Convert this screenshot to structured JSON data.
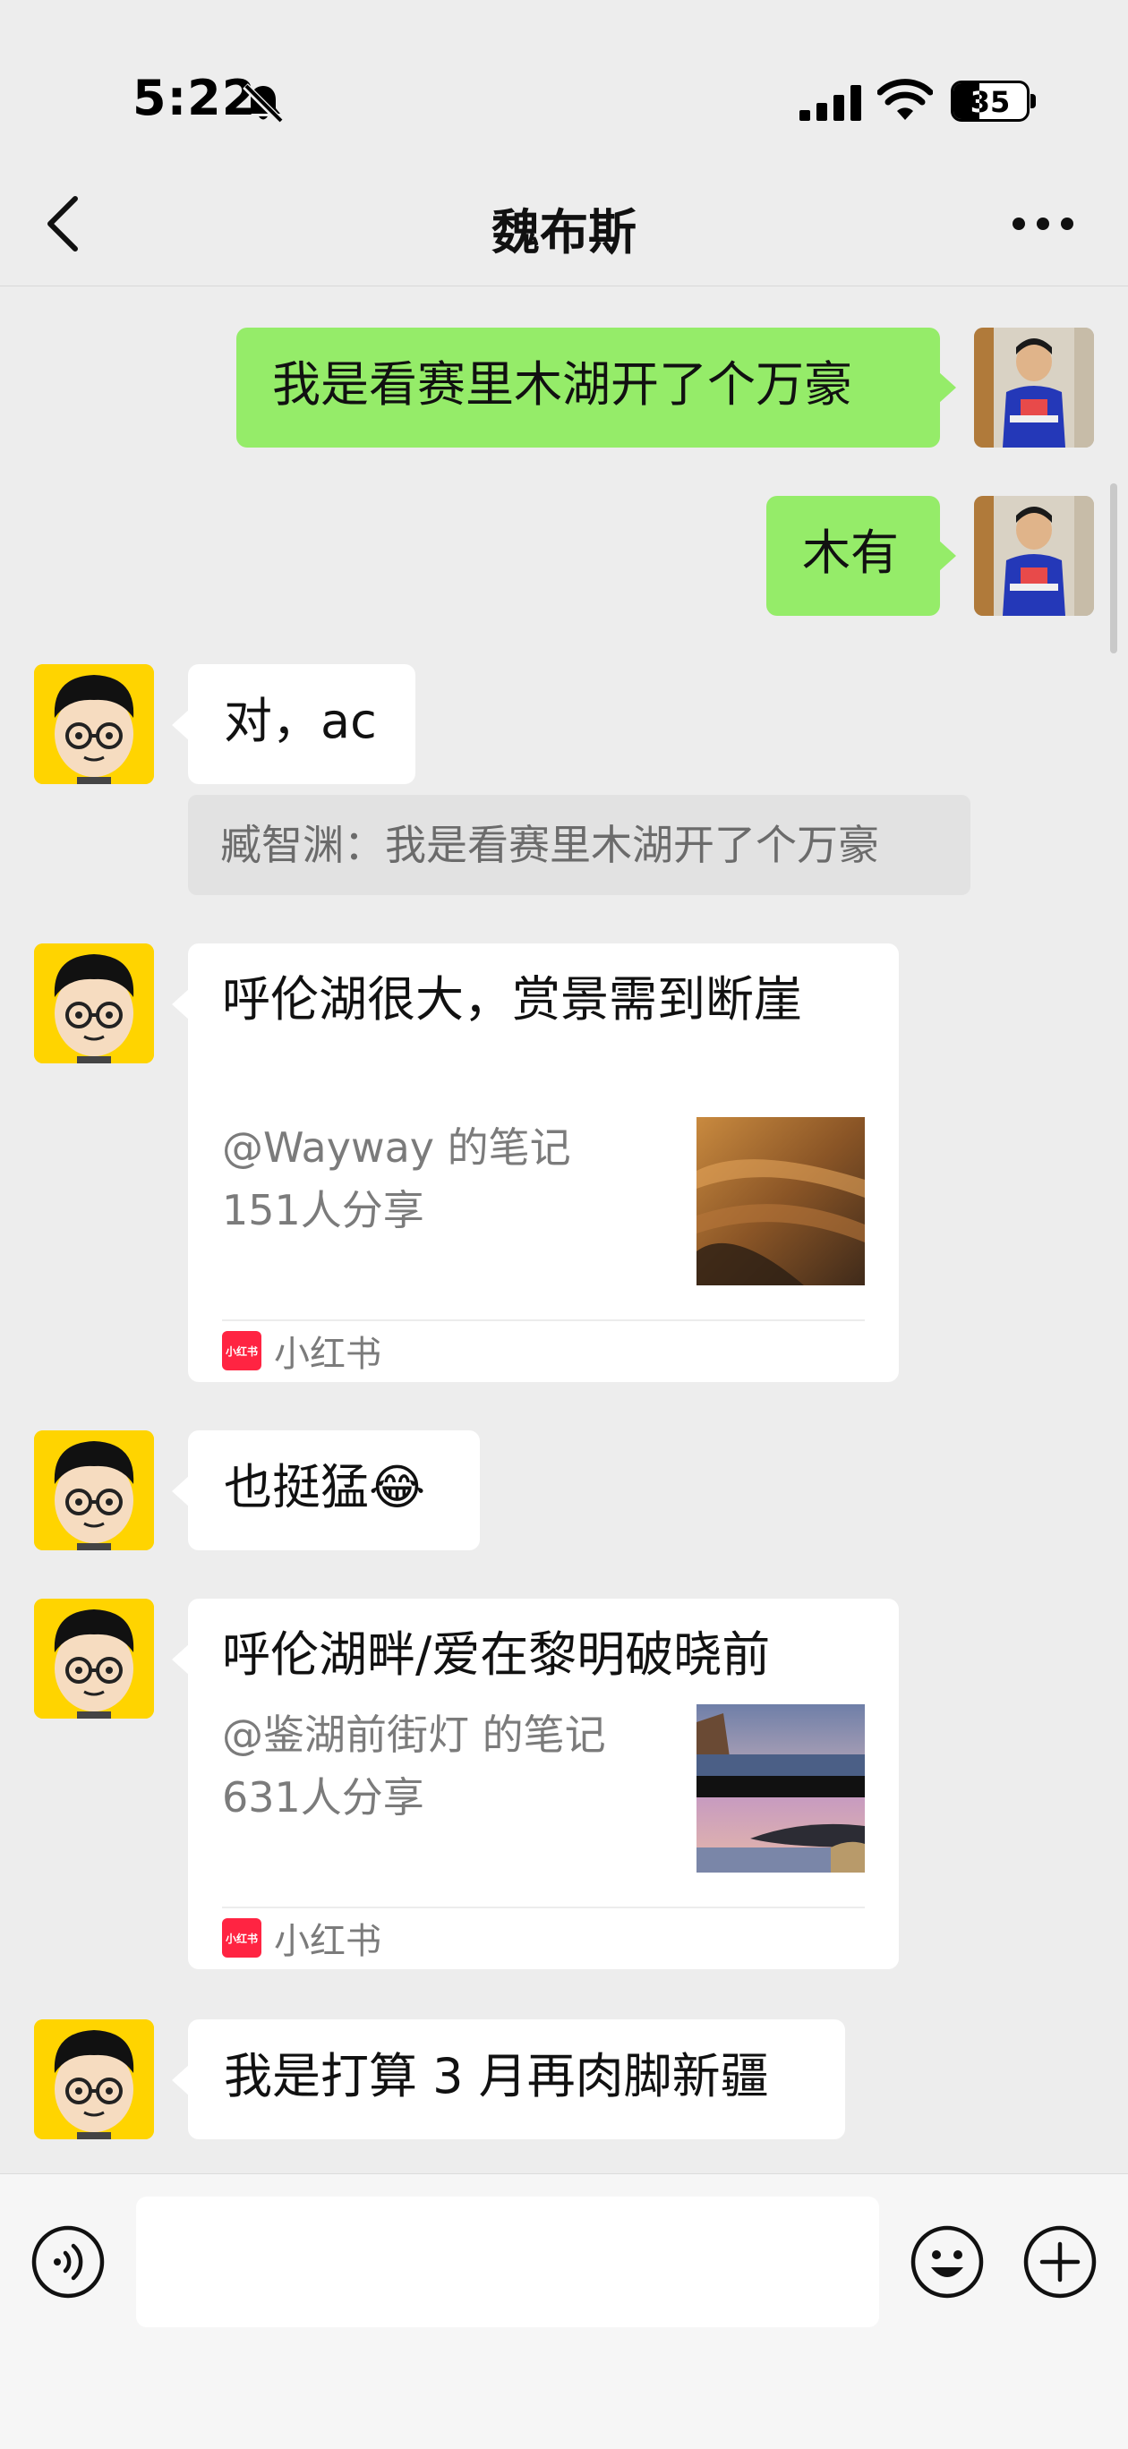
{
  "status_bar": {
    "time": "5:22",
    "battery_level": "35",
    "icons": [
      "bell-mute-icon",
      "cellular-signal-icon",
      "wifi-icon",
      "battery-icon"
    ]
  },
  "nav": {
    "title": "魏布斯",
    "back_icon": "chevron-left-icon",
    "more_icon": "ellipsis-icon"
  },
  "messages": [
    {
      "from": "self",
      "text": "我是看赛里木湖开了个万豪"
    },
    {
      "from": "self",
      "text": "木有"
    },
    {
      "from": "other",
      "text": "对，ac",
      "quote": "臧智渊：我是看赛里木湖开了个万豪"
    },
    {
      "from": "other",
      "type": "card",
      "title": "呼伦湖很大，赏景需到断崖",
      "author": "@Wayway 的笔记",
      "shares": "151人分享",
      "source": "小红书",
      "logo_text": "小红书"
    },
    {
      "from": "other",
      "text": "也挺猛😂"
    },
    {
      "from": "other",
      "type": "card",
      "title": "呼伦湖畔/爱在黎明破晓前",
      "author": "@鉴湖前街灯 的笔记",
      "shares": "631人分享",
      "source": "小红书",
      "logo_text": "小红书"
    },
    {
      "from": "other",
      "text": "我是打算 3 月再肉脚新疆"
    }
  ],
  "input_bar": {
    "placeholder": "",
    "icons": [
      "voice-icon",
      "emoji-icon",
      "plus-icon"
    ]
  },
  "colors": {
    "background": "#ededed",
    "self_bubble": "#95ec69",
    "other_bubble": "#ffffff",
    "avatar_yellow": "#ffd400",
    "xiaohongshu_red": "#ff2442"
  }
}
